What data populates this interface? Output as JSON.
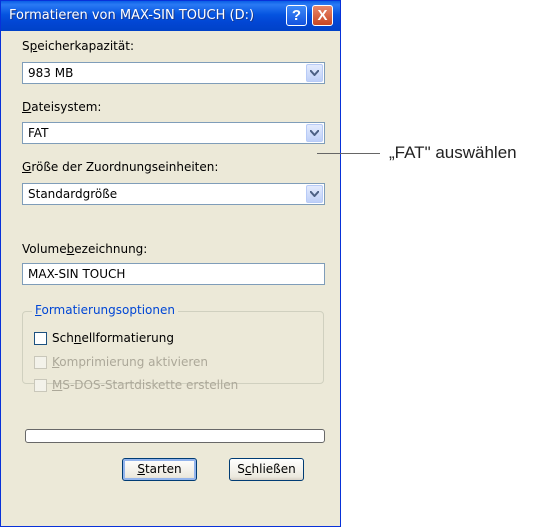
{
  "window": {
    "title": "Formatieren von MAX-SIN TOUCH (D:)",
    "help_icon": "?",
    "close_icon": "X"
  },
  "capacity": {
    "label_pre": "S",
    "label_u": "p",
    "label_post": "eicherkapazität:",
    "value": "983 MB"
  },
  "filesystem": {
    "label_pre": "",
    "label_u": "D",
    "label_post": "ateisystem:",
    "value": "FAT"
  },
  "allocation": {
    "label_pre": "",
    "label_u": "G",
    "label_post": "röße der Zuordnungseinheiten:",
    "value": "Standardgröße"
  },
  "volume": {
    "label_pre": "Volume",
    "label_u": "b",
    "label_post": "ezeichnung:",
    "value": "MAX-SIN TOUCH"
  },
  "options": {
    "title_pre": "",
    "title_u": "F",
    "title_post": "ormatierungsoptionen",
    "quick": {
      "pre": "Sch",
      "u": "n",
      "post": "ellformatierung",
      "checked": false,
      "enabled": true
    },
    "compress": {
      "pre": "",
      "u": "K",
      "post": "omprimierung aktivieren",
      "checked": false,
      "enabled": false
    },
    "msdos": {
      "pre": "",
      "u": "M",
      "post": "S-DOS-Startdiskette erstellen",
      "checked": false,
      "enabled": false
    }
  },
  "progress": {
    "fraction": 0
  },
  "buttons": {
    "start": {
      "pre": "",
      "u": "S",
      "post": "tarten"
    },
    "close": {
      "pre": "S",
      "u": "c",
      "post": "hließen"
    }
  },
  "callout": {
    "text": "„FAT\" auswählen"
  }
}
